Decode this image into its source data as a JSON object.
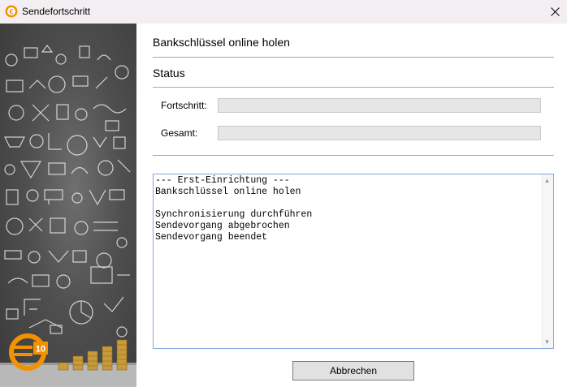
{
  "window": {
    "title": "Sendefortschritt",
    "close_icon": "close-icon"
  },
  "main": {
    "heading": "Bankschlüssel online holen",
    "status_heading": "Status",
    "progress_label": "Fortschritt:",
    "progress_value": 0,
    "total_label": "Gesamt:",
    "total_value": 0
  },
  "log": {
    "text": "--- Erst-Einrichtung ---\nBankschlüssel online holen\n\nSynchronisierung durchführen\nSendevorgang abgebrochen\nSendevorgang beendet"
  },
  "buttons": {
    "cancel_label": "Abbrechen"
  },
  "side_panel": {
    "logo_text": "10",
    "logo_color": "#f29200"
  },
  "colors": {
    "log_border": "#7fa7d6",
    "progress_track": "#e6e6e6"
  }
}
